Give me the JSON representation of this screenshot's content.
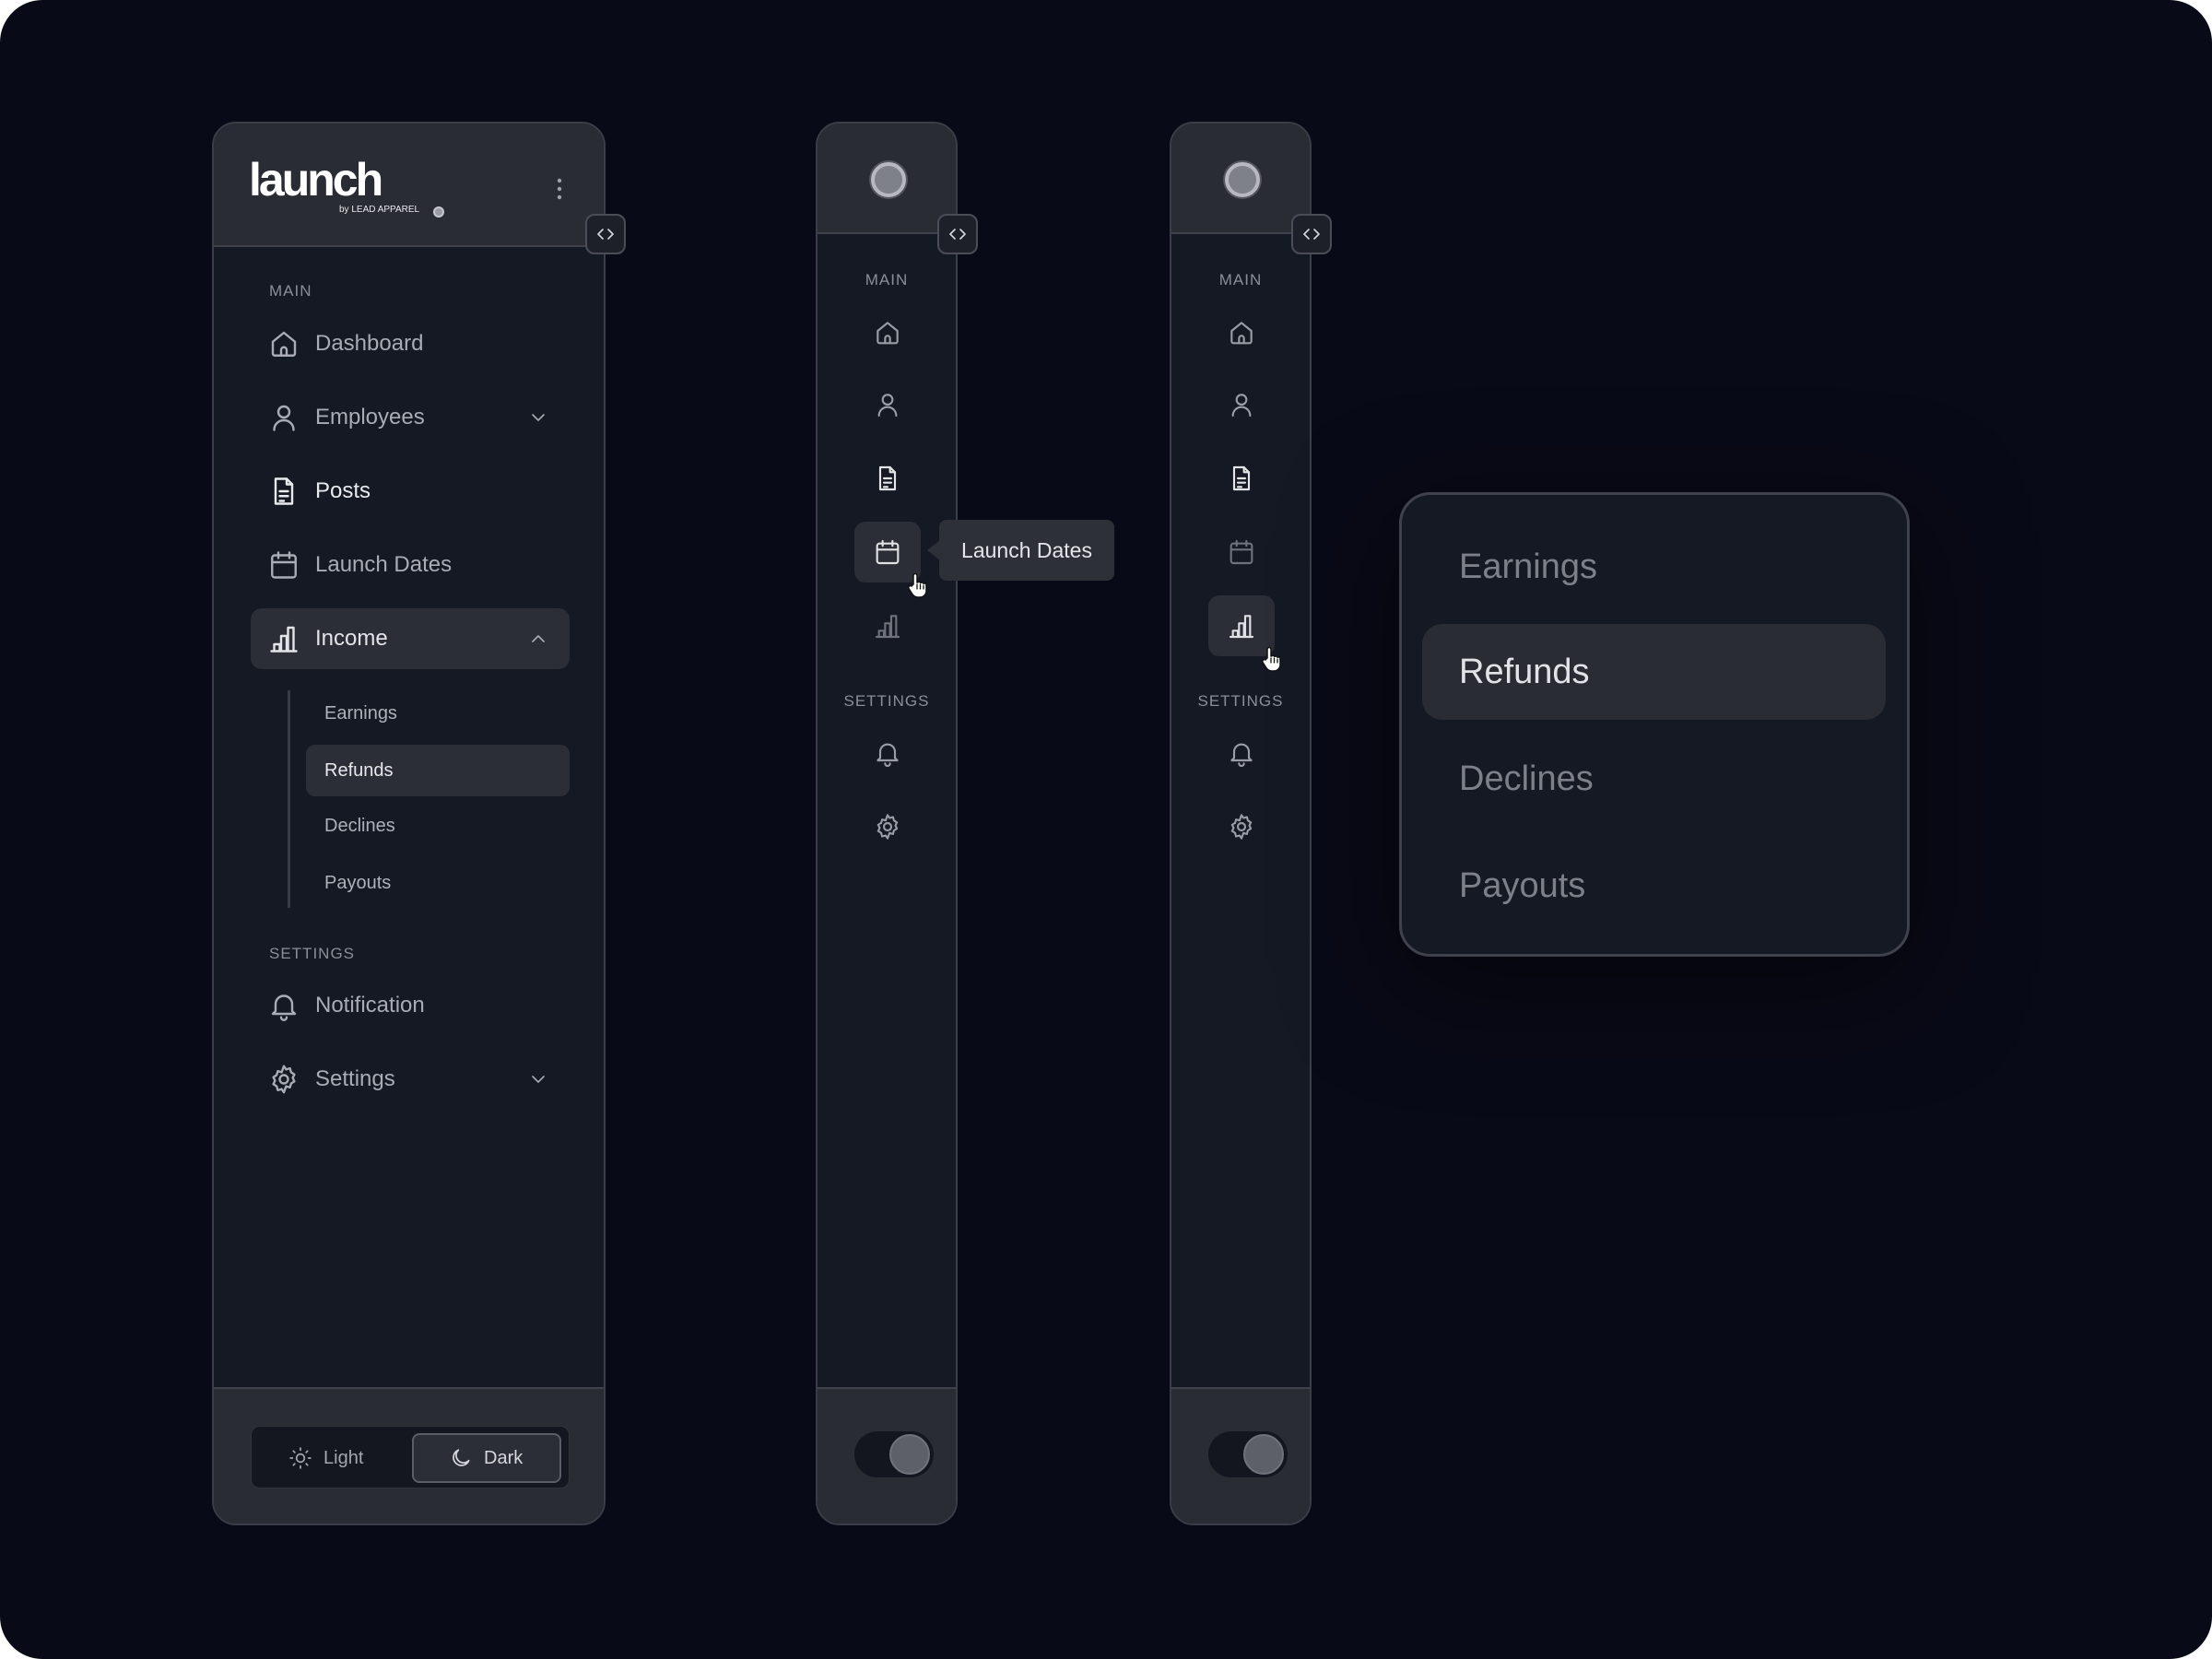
{
  "brand": {
    "wordmark": "launch",
    "tagline": "by LEAD APPAREL"
  },
  "sidebar": {
    "main_label": "MAIN",
    "settings_label": "SETTINGS",
    "items": [
      {
        "label": "Dashboard",
        "icon": "home-icon"
      },
      {
        "label": "Employees",
        "icon": "user-icon",
        "chevron": "chevron-down-icon"
      },
      {
        "label": "Posts",
        "icon": "document-icon"
      },
      {
        "label": "Launch Dates",
        "icon": "calendar-icon"
      },
      {
        "label": "Income",
        "icon": "bar-chart-icon",
        "chevron": "chevron-up-icon",
        "expanded": true
      }
    ],
    "income_submenu": [
      "Earnings",
      "Refunds",
      "Declines",
      "Payouts"
    ],
    "active_submenu": "Refunds",
    "settings_items": [
      {
        "label": "Notification",
        "icon": "bell-icon"
      },
      {
        "label": "Settings",
        "icon": "gear-icon",
        "chevron": "chevron-down-icon"
      }
    ],
    "theme": {
      "light_label": "Light",
      "dark_label": "Dark",
      "selected": "Dark"
    }
  },
  "collapsed_a": {
    "main_label": "MAIN",
    "settings_label": "SETTINGS",
    "tooltip": "Launch Dates"
  },
  "collapsed_b": {
    "main_label": "MAIN",
    "settings_label": "SETTINGS"
  },
  "popover": {
    "items": [
      "Earnings",
      "Refunds",
      "Declines",
      "Payouts"
    ],
    "active": "Refunds"
  },
  "colors": {
    "background": "#090a17",
    "panel": "#151923",
    "panel_header": "#2a2c33",
    "active_item": "#2b2e36"
  }
}
